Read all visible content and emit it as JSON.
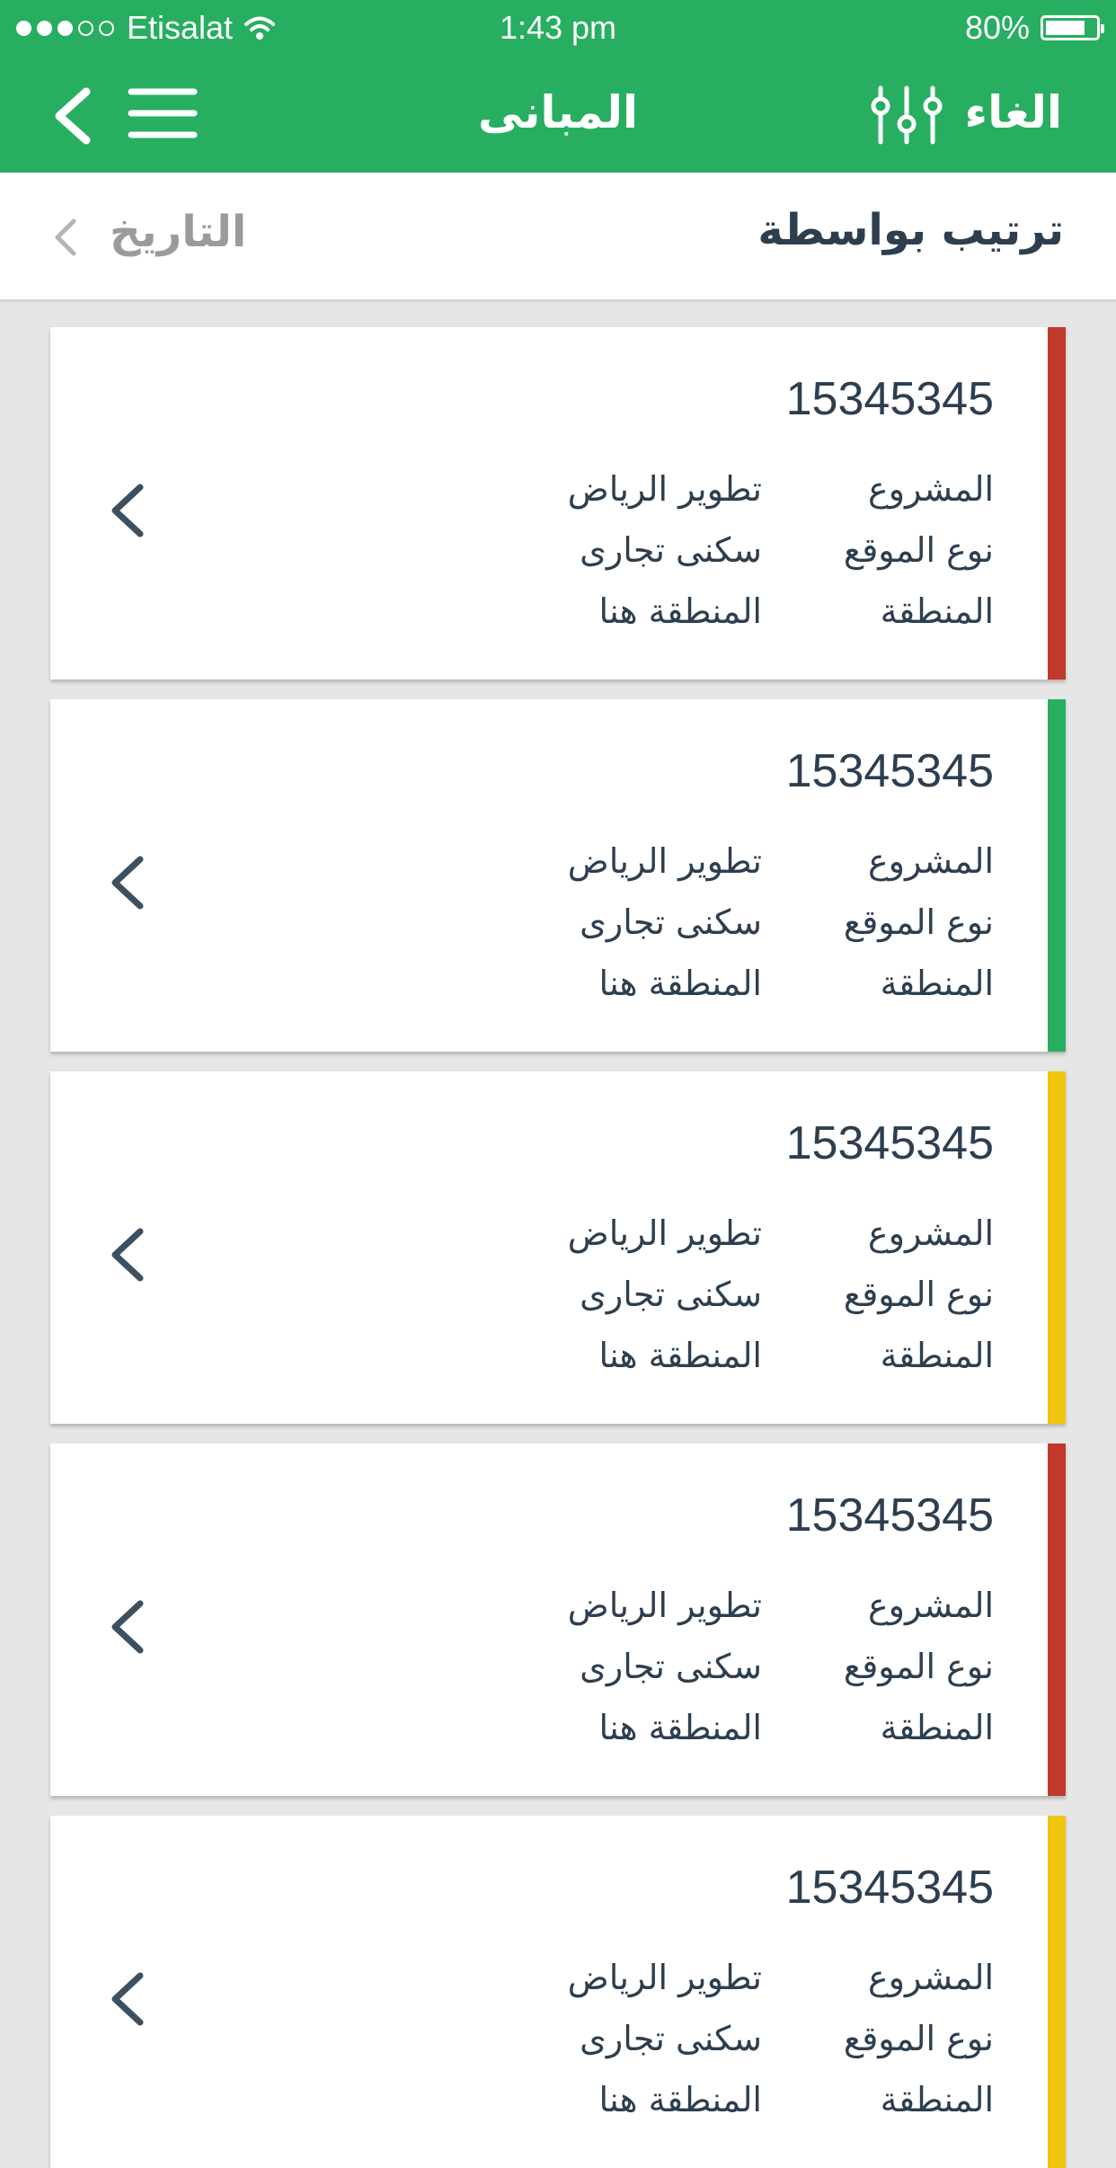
{
  "status_bar": {
    "carrier": "Etisalat",
    "time": "1:43 pm",
    "battery": "80%",
    "battery_level": 0.8
  },
  "nav": {
    "title": "المبانى",
    "cancel_label": "الغاء"
  },
  "sort": {
    "label": "ترتيب بواسطة",
    "value": "التاريخ"
  },
  "colors": {
    "header": "#27ae60",
    "red": "#c0392b",
    "green": "#27ae60",
    "yellow": "#f1c40f",
    "text": "#2d3e4f"
  },
  "cards": [
    {
      "id": "15345345",
      "status_color": "#c0392b",
      "rows": [
        {
          "label": "المشروع",
          "value": "تطوير الرياض"
        },
        {
          "label": "نوع الموقع",
          "value": "سكنى تجارى"
        },
        {
          "label": "المنطقة",
          "value": "المنطقة هنا"
        }
      ]
    },
    {
      "id": "15345345",
      "status_color": "#27ae60",
      "rows": [
        {
          "label": "المشروع",
          "value": "تطوير الرياض"
        },
        {
          "label": "نوع الموقع",
          "value": "سكنى تجارى"
        },
        {
          "label": "المنطقة",
          "value": "المنطقة هنا"
        }
      ]
    },
    {
      "id": "15345345",
      "status_color": "#f1c40f",
      "rows": [
        {
          "label": "المشروع",
          "value": "تطوير الرياض"
        },
        {
          "label": "نوع الموقع",
          "value": "سكنى تجارى"
        },
        {
          "label": "المنطقة",
          "value": "المنطقة هنا"
        }
      ]
    },
    {
      "id": "15345345",
      "status_color": "#c0392b",
      "rows": [
        {
          "label": "المشروع",
          "value": "تطوير الرياض"
        },
        {
          "label": "نوع الموقع",
          "value": "سكنى تجارى"
        },
        {
          "label": "المنطقة",
          "value": "المنطقة هنا"
        }
      ]
    },
    {
      "id": "15345345",
      "status_color": "#f1c40f",
      "rows": [
        {
          "label": "المشروع",
          "value": "تطوير الرياض"
        },
        {
          "label": "نوع الموقع",
          "value": "سكنى تجارى"
        },
        {
          "label": "المنطقة",
          "value": "المنطقة هنا"
        }
      ]
    }
  ]
}
